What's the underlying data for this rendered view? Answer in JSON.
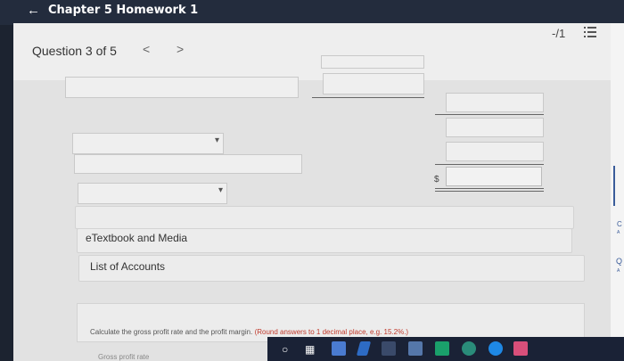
{
  "header": {
    "back_icon": "arrow-left-icon",
    "title": "Chapter 5 Homework 1"
  },
  "question": {
    "label": "Question 3 of 5",
    "prev": "<",
    "next": ">",
    "score": "-/1"
  },
  "form": {
    "currency_symbol": "$"
  },
  "sections": {
    "etextbook": "eTextbook and Media",
    "accounts": "List of Accounts"
  },
  "calculation": {
    "prompt": "Calculate the gross profit rate and the profit margin.",
    "instruction": "(Round answers to 1 decimal place, e.g. 15.2%.)",
    "cut_off_label": "Gross profit rate"
  },
  "colors": {
    "accent": "#3a5c9a",
    "instruction_red": "#c0392b"
  }
}
